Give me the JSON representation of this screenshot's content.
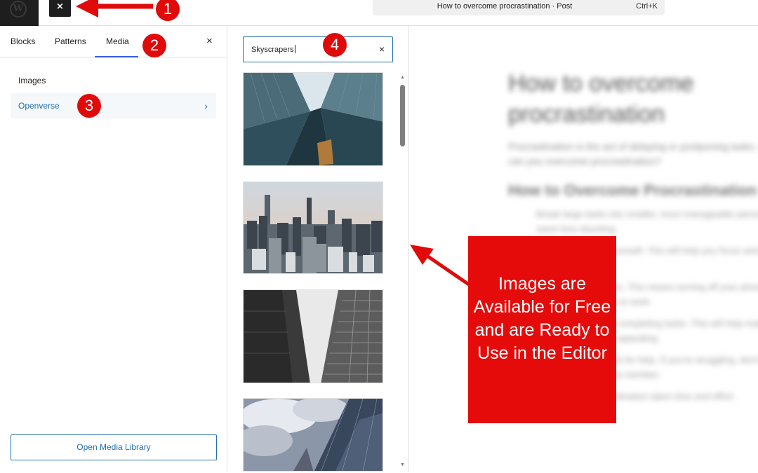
{
  "topbar": {
    "wp_logo_glyph": "W",
    "close_inserter_glyph": "×",
    "document_title": "How to overcome procrastination · Post",
    "command_shortcut": "Ctrl+K"
  },
  "inserter": {
    "tabs": [
      {
        "label": "Blocks"
      },
      {
        "label": "Patterns"
      },
      {
        "label": "Media",
        "active": true
      }
    ],
    "close_glyph": "×",
    "categories": [
      {
        "label": "Images"
      },
      {
        "label": "Openverse",
        "selected": true,
        "chevron": "›"
      }
    ],
    "open_media_label": "Open Media Library"
  },
  "media": {
    "search_value": "Skyscrapers",
    "clear_glyph": "×",
    "results": [
      {
        "icon": "skyscrapers-looking-up-photo"
      },
      {
        "icon": "city-skyline-aerial-photo"
      },
      {
        "icon": "black-white-towers-photo"
      },
      {
        "icon": "glass-tower-clouds-photo"
      }
    ],
    "scroll_up_glyph": "▲",
    "scroll_down_glyph": "▼"
  },
  "editor": {
    "post_title": "How to overcome procrastination",
    "paragraph": "Procrastination is the act of delaying or postponing tasks. So how can you overcome procrastination?",
    "heading": "How to Overcome Procrastination",
    "list_items": [
      "Break large tasks into smaller, more manageable pieces that seem less daunting.",
      "Set a deadline for yourself. This will help you focus and get things off your list.",
      "Eliminate distractions. This means turning off your phone and finding a quiet place to work.",
      "Reward yourself for completing tasks. This will help make procrastination less appealing.",
      "Don't be afraid to ask for help. If you're struggling, don't be afraid to ask a friend, family member.",
      "Overcoming procrastination takes time and effort."
    ]
  },
  "annotations": {
    "callout_text": "Images are Available for Free and are Ready to Use in the Editor",
    "badges": [
      "1",
      "2",
      "3",
      "4"
    ],
    "color": "#e00a0a"
  }
}
